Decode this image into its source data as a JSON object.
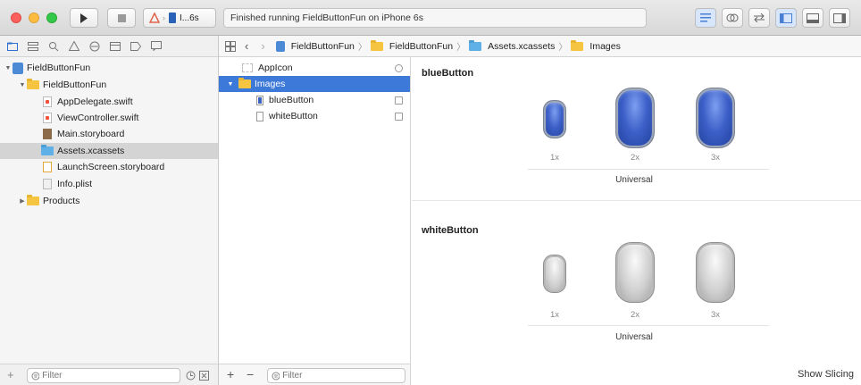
{
  "toolbar": {
    "scheme_label": "I...6s",
    "status_text": "Finished running FieldButtonFun on iPhone 6s"
  },
  "navigator": {
    "tree": [
      {
        "label": "FieldButtonFun",
        "kind": "project",
        "depth": 0,
        "expanded": true
      },
      {
        "label": "FieldButtonFun",
        "kind": "folder",
        "depth": 1,
        "expanded": true
      },
      {
        "label": "AppDelegate.swift",
        "kind": "swift",
        "depth": 2
      },
      {
        "label": "ViewController.swift",
        "kind": "swift",
        "depth": 2
      },
      {
        "label": "Main.storyboard",
        "kind": "storyboard",
        "depth": 2
      },
      {
        "label": "Assets.xcassets",
        "kind": "assets",
        "depth": 2,
        "selected": true
      },
      {
        "label": "LaunchScreen.storyboard",
        "kind": "launchscreen",
        "depth": 2
      },
      {
        "label": "Info.plist",
        "kind": "plist",
        "depth": 2
      },
      {
        "label": "Products",
        "kind": "folder",
        "depth": 1,
        "expanded": false
      }
    ],
    "filter_placeholder": "Filter"
  },
  "jumpbar": {
    "crumbs": [
      "FieldButtonFun",
      "FieldButtonFun",
      "Assets.xcassets",
      "Images"
    ]
  },
  "asset_list": {
    "items": [
      {
        "label": "AppIcon",
        "kind": "appicon"
      },
      {
        "label": "Images",
        "kind": "folder",
        "selected": true
      },
      {
        "label": "blueButton",
        "kind": "imageset-blue"
      },
      {
        "label": "whiteButton",
        "kind": "imageset-white"
      }
    ],
    "filter_placeholder": "Filter"
  },
  "detail": {
    "sets": [
      {
        "name": "blueButton",
        "color": "blue",
        "scales": [
          "1x",
          "2x",
          "3x"
        ],
        "idiom": "Universal"
      },
      {
        "name": "whiteButton",
        "color": "white",
        "scales": [
          "1x",
          "2x",
          "3x"
        ],
        "idiom": "Universal"
      }
    ],
    "show_slicing_label": "Show Slicing"
  },
  "colors": {
    "selection_blue": "#3d79d8",
    "folder_yellow": "#f5c542"
  }
}
